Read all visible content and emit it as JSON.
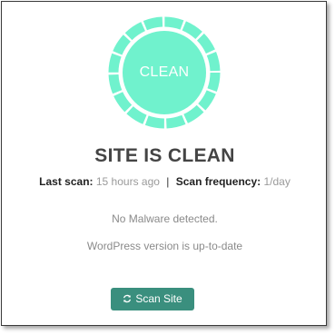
{
  "status": {
    "label": "CLEAN",
    "ring_color": "#70f2cd",
    "icon": "shield-clean-ring-icon"
  },
  "title": "SITE IS CLEAN",
  "meta": {
    "last_scan_label": "Last scan:",
    "last_scan_value": "15 hours ago",
    "separator": "|",
    "frequency_label": "Scan frequency:",
    "frequency_value": "1/day"
  },
  "messages": [
    "No Malware detected.",
    "WordPress version is up-to-date"
  ],
  "scan_button": {
    "label": "Scan Site",
    "icon": "refresh-icon",
    "color": "#3a8f7e"
  }
}
